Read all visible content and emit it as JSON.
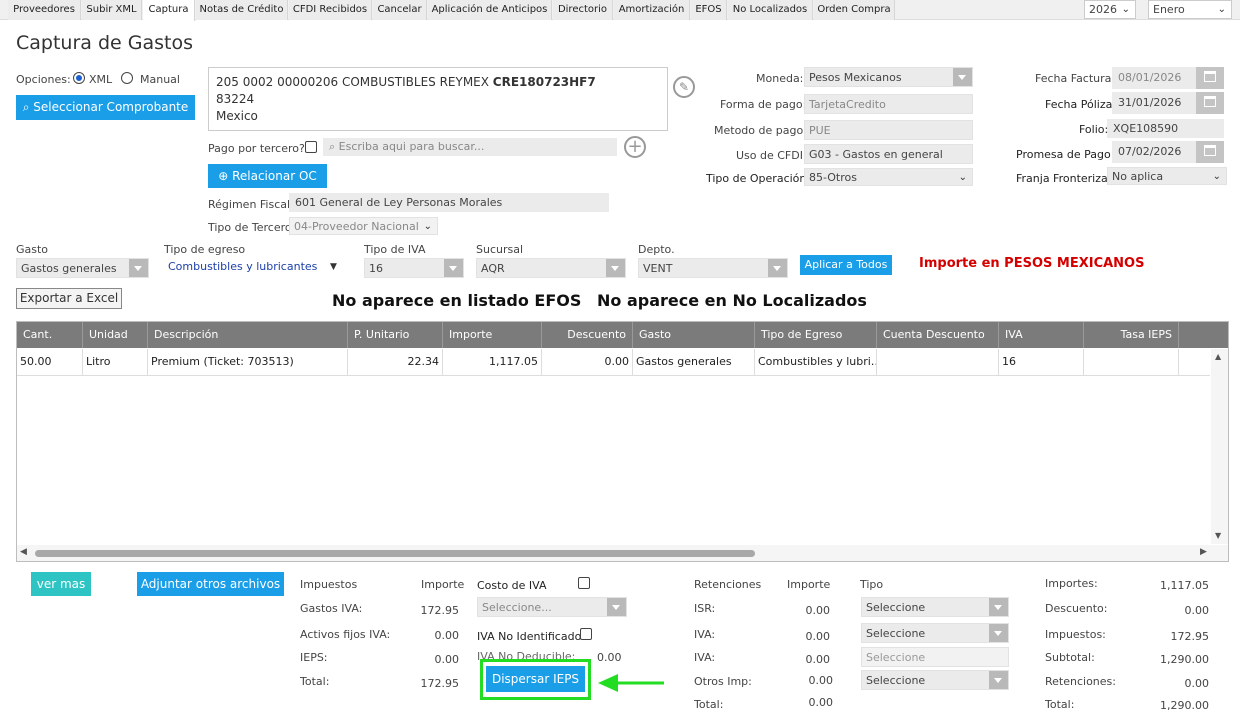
{
  "tabs": [
    "Proveedores",
    "Subir XML",
    "Captura",
    "Notas de Crédito",
    "CFDI Recibidos",
    "Cancelar",
    "Aplicación de Anticipos",
    "Directorio",
    "Amortización",
    "EFOS",
    "No Localizados",
    "Orden Compra"
  ],
  "year": "2026",
  "month": "Enero",
  "page_title": "Captura de Gastos",
  "opciones": {
    "label": "Opciones:",
    "xml": "XML",
    "manual": "Manual",
    "select_btn": "Seleccionar Comprobante"
  },
  "proveedor": {
    "line1": "205 0002 00000206 COMBUSTIBLES REYMEX ",
    "rfc": "CRE180723HF7",
    "line2": "83224",
    "line3": "Mexico"
  },
  "tercero": {
    "label": "Pago por tercero?",
    "placeholder": "Escriba aqui para buscar..."
  },
  "relacionar_btn": "Relacionar OC",
  "regimen": {
    "label": "Régimen Fiscal:",
    "value": "601 General de Ley Personas Morales"
  },
  "tipo_tercero": {
    "label": "Tipo de Tercero:",
    "value": "04-Proveedor Nacional"
  },
  "mid": {
    "moneda_l": "Moneda:",
    "moneda": "Pesos Mexicanos",
    "forma_l": "Forma de pago:",
    "forma": "TarjetaCredito",
    "metodo_l": "Metodo de pago:",
    "metodo": "PUE",
    "uso_l": "Uso de CFDI:",
    "uso": "G03 - Gastos en general",
    "tipoop_l": "Tipo de Operación:",
    "tipoop": "85-Otros"
  },
  "right": {
    "ffact_l": "Fecha Factura:",
    "ffact": "08/01/2026",
    "fpol_l": "Fecha Póliza",
    "fpol": "31/01/2026",
    "folio_l": "Folio:",
    "folio": "XQE108590",
    "prom_l": "Promesa de Pago:",
    "prom": "07/02/2026",
    "franja_l": "Franja Fronteriza:",
    "franja": "No aplica"
  },
  "filters": {
    "gasto_l": "Gasto",
    "gasto": "Gastos generales",
    "egreso_l": "Tipo de egreso",
    "egreso": "Combustibles y lubricantes",
    "iva_l": "Tipo de IVA",
    "iva": "16",
    "suc_l": "Sucursal",
    "suc": "AQR",
    "depto_l": "Depto.",
    "depto": "VENT",
    "aplicar": "Aplicar a Todos",
    "importe_note": "Importe en PESOS MEXICANOS"
  },
  "exportar": "Exportar a Excel",
  "efos_msg": "No aparece en listado EFOS",
  "noloc_msg": "No aparece en No Localizados",
  "grid": {
    "headers": [
      "Cant.",
      "Unidad",
      "Descripción",
      "P. Unitario",
      "Importe",
      "Descuento",
      "Gasto",
      "Tipo de Egreso",
      "Cuenta Descuento",
      "IVA",
      "Tasa IEPS"
    ],
    "row": [
      "50.00",
      "Litro",
      "Premium (Ticket: 703513)",
      "22.34",
      "1,117.05",
      "0.00",
      "Gastos generales",
      "Combustibles y lubri…",
      "",
      "16",
      ""
    ]
  },
  "vermas": "ver mas",
  "adjuntar": "Adjuntar otros archivos",
  "impuestos": {
    "h1": "Impuestos",
    "h2": "Importe",
    "rows": [
      [
        "Gastos IVA:",
        "172.95"
      ],
      [
        "Activos fijos IVA:",
        "0.00"
      ],
      [
        "IEPS:",
        "0.00"
      ],
      [
        "Total:",
        "172.95"
      ]
    ]
  },
  "costo": {
    "label": "Costo de IVA",
    "sel": "Seleccione...",
    "noid": "IVA No Identificado",
    "nodeduc": "IVA No Deducible:",
    "nodeduc_v": "0.00"
  },
  "dispersar": "Dispersar IEPS",
  "ret": {
    "h1": "Retenciones",
    "h2": "Importe",
    "h3": "Tipo",
    "rows": [
      [
        "ISR:",
        "0.00",
        "Seleccione"
      ],
      [
        "IVA:",
        "0.00",
        "Seleccione"
      ],
      [
        "IVA:",
        "0.00",
        "Seleccione"
      ],
      [
        "Otros Imp:",
        "0.00",
        "Seleccione"
      ],
      [
        "Total:",
        "0.00",
        ""
      ]
    ]
  },
  "totals": [
    [
      "Importes:",
      "1,117.05"
    ],
    [
      "Descuento:",
      "0.00"
    ],
    [
      "Impuestos:",
      "172.95"
    ],
    [
      "Subtotal:",
      "1,290.00"
    ],
    [
      "Retenciones:",
      "0.00"
    ],
    [
      "Total:",
      "1,290.00"
    ]
  ],
  "colors": {
    "accent": "#1a9ee8",
    "teal": "#2ec4c4",
    "highlight": "#22dd22",
    "red": "#d40000"
  }
}
